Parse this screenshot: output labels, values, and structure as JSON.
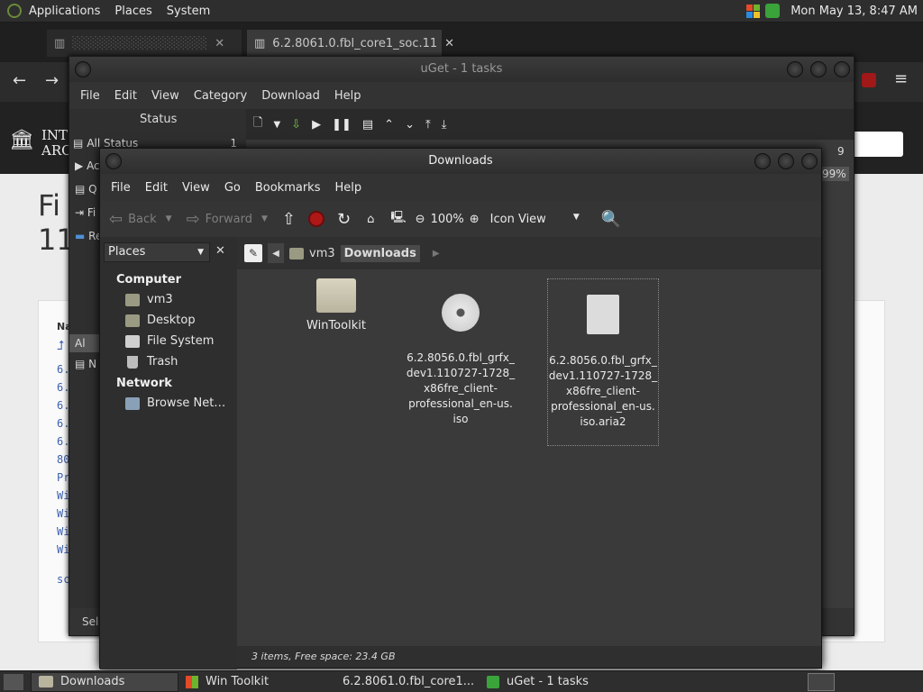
{
  "top_panel": {
    "menus": [
      "Applications",
      "Places",
      "System"
    ],
    "clock": "Mon May 13,  8:47 AM"
  },
  "browser": {
    "tabs": [
      "6.2.8061.0.fbl_core1_soc.11",
      ""
    ],
    "page_title_fragment": "Fi",
    "page_title_fragment2": "11",
    "list_header": "Na",
    "list_rows": [
      "6.",
      "6.",
      "6.",
      "6.",
      "6.",
      "80",
      "Pr",
      "Wi",
      "Wi",
      "Wi",
      "Wi"
    ],
    "footer_frag": "sc",
    "banner_frag1": "INT",
    "banner_frag2": "ARC"
  },
  "uget": {
    "title": "uGet - 1 tasks",
    "menus": [
      "File",
      "Edit",
      "View",
      "Category",
      "Download",
      "Help"
    ],
    "status_header": "Status",
    "side_items": [
      {
        "label": "All Status",
        "count": "1"
      },
      {
        "label": "Ac",
        "count": ""
      },
      {
        "label": "Q",
        "count": ""
      },
      {
        "label": "Fi",
        "count": ""
      },
      {
        "label": "Re",
        "count": ""
      }
    ],
    "side_items2": [
      {
        "label": "Al"
      },
      {
        "label": "N"
      }
    ],
    "percent": "99%",
    "count_right": "9",
    "status_frag": "Sele"
  },
  "files": {
    "title": "Downloads",
    "menus": [
      "File",
      "Edit",
      "View",
      "Go",
      "Bookmarks",
      "Help"
    ],
    "toolbar": {
      "back": "Back",
      "forward": "Forward",
      "zoom": "100%",
      "view_mode": "Icon View"
    },
    "sidebar": {
      "combo": "Places",
      "headings": [
        "Computer",
        "Network"
      ],
      "computer_items": [
        "vm3",
        "Desktop",
        "File System",
        "Trash"
      ],
      "network_items": [
        "Browse Net…"
      ]
    },
    "path": [
      "vm3",
      "Downloads"
    ],
    "items": [
      {
        "name": "WinToolkit",
        "type": "folder"
      },
      {
        "name": "6.2.8056.0.fbl_grfx_\ndev1.110727-1728_\nx86fre_client-\nprofessional_en-us.\niso",
        "type": "disc"
      },
      {
        "name": "6.2.8056.0.fbl_grfx_\ndev1.110727-1728_\nx86fre_client-\nprofessional_en-us.\niso.aria2",
        "type": "file"
      }
    ],
    "status": "3 items, Free space: 23.4 GB"
  },
  "taskbar": {
    "tasks": [
      "Downloads",
      "Win Toolkit",
      "6.2.8061.0.fbl_core1...",
      "uGet - 1 tasks"
    ]
  }
}
